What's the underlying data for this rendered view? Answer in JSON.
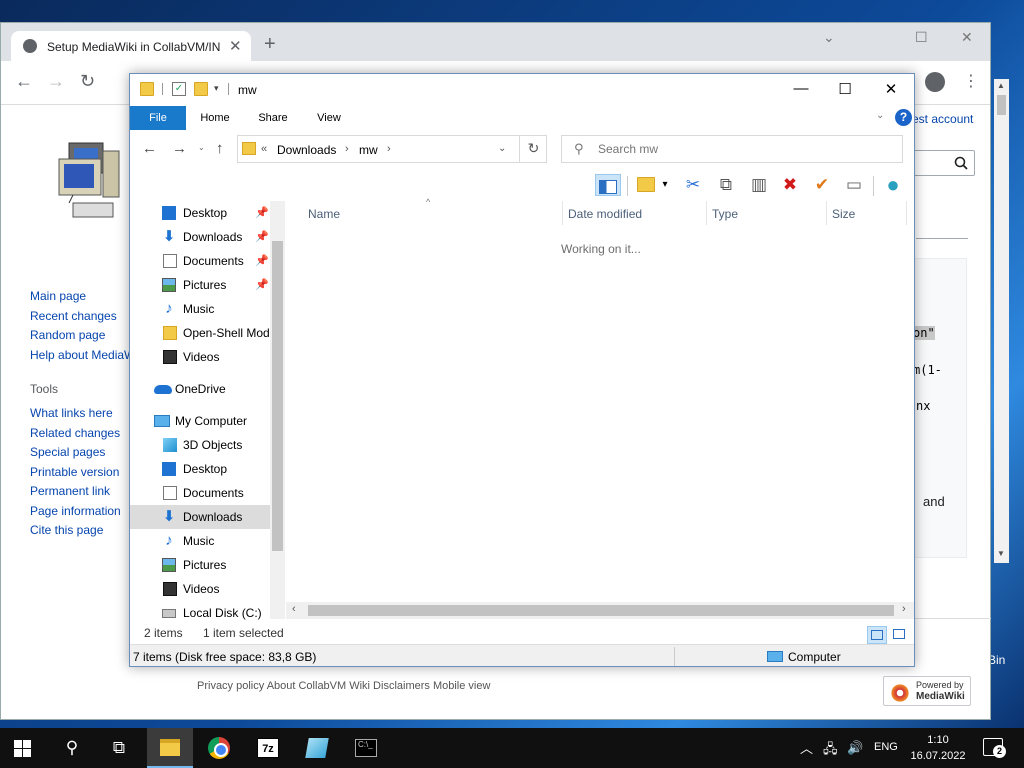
{
  "desktop": {
    "partial_label": "Bin"
  },
  "chrome": {
    "tab_title": "Setup MediaWiki in CollabVM/IN",
    "tab_close": "✕",
    "new_tab": "+",
    "ctrl_minimize": "⌄",
    "ctrl_restore": "☐",
    "ctrl_close": "✕",
    "nav_back": "←",
    "nav_forward": "→",
    "nav_reload": "↻",
    "menu": "⋮"
  },
  "wiki": {
    "nav_links": [
      "Main page",
      "Recent changes",
      "Random page",
      "Help about MediaWiki"
    ],
    "tools_heading": "Tools",
    "tools_links": [
      "What links here",
      "Related changes",
      "Special pages",
      "Printable version",
      "Permanent link",
      "Page information",
      "Cite this page"
    ],
    "account_link": "est account",
    "code_fragments": [
      "on\"",
      "m(1-",
      "nx"
    ],
    "text_fragment": "and",
    "footer_links": "Privacy policy   About CollabVM Wiki   Disclaimers   Mobile view",
    "powered_by_line1": "Powered by",
    "powered_by_line2": "MediaWiki"
  },
  "explorer": {
    "title": "mw",
    "window_minimize": "—",
    "window_maximize": "☐",
    "window_close": "✕",
    "ribbon_tabs": [
      "File",
      "Home",
      "Share",
      "View"
    ],
    "ribbon_collapse": "⌄",
    "help": "?",
    "nav_back": "←",
    "nav_forward": "→",
    "nav_recent": "⌄",
    "nav_up": "↑",
    "breadcrumb_overflow": "«",
    "breadcrumb": [
      "Downloads",
      "mw"
    ],
    "breadcrumb_separator": "›",
    "address_dropdown": "⌄",
    "refresh": "↻",
    "search_placeholder": "Search mw",
    "search_glyph": "⚲",
    "toolbar_glyphs": {
      "dropdown": "▾",
      "cut": "✂",
      "copy": "⧉",
      "paste": "▥",
      "delete": "✖",
      "apply": "✔",
      "rename": "▭",
      "globe": "●"
    },
    "toolbar_colors": {
      "cut": "#2a6fd6",
      "copy": "#555555",
      "paste": "#555555",
      "delete": "#d11a1a",
      "apply": "#e07a1a",
      "rename": "#666666",
      "globe": "#2aa0c0"
    },
    "nav_pane": {
      "quick_access": [
        {
          "label": "Desktop",
          "icon": "desktop-icon",
          "pinned": true
        },
        {
          "label": "Downloads",
          "icon": "downloads-icon",
          "pinned": true
        },
        {
          "label": "Documents",
          "icon": "documents-icon",
          "pinned": true
        },
        {
          "label": "Pictures",
          "icon": "pictures-icon",
          "pinned": true
        },
        {
          "label": "Music",
          "icon": "music-icon",
          "pinned": false
        },
        {
          "label": "Open-Shell Mod",
          "icon": "folder-icon",
          "pinned": false
        },
        {
          "label": "Videos",
          "icon": "videos-icon",
          "pinned": false
        }
      ],
      "onedrive": "OneDrive",
      "my_computer": "My Computer",
      "computer_items": [
        {
          "label": "3D Objects",
          "icon": "3d-objects-icon"
        },
        {
          "label": "Desktop",
          "icon": "desktop-icon"
        },
        {
          "label": "Documents",
          "icon": "documents-icon"
        },
        {
          "label": "Downloads",
          "icon": "downloads-icon",
          "selected": true
        },
        {
          "label": "Music",
          "icon": "music-icon"
        },
        {
          "label": "Pictures",
          "icon": "pictures-icon"
        },
        {
          "label": "Videos",
          "icon": "videos-icon"
        },
        {
          "label": "Local Disk (C:)",
          "icon": "local-disk-icon"
        }
      ],
      "pin_glyph": "📌",
      "down_glyph": "⬇",
      "music_glyph": "♪"
    },
    "columns": [
      "Name",
      "Date modified",
      "Type",
      "Size"
    ],
    "sort_indicator": "^",
    "status_message": "Working on it...",
    "scroll_left": "‹",
    "scroll_right": "›",
    "status_items": "2 items",
    "status_selected": "1 item selected",
    "status_bar_left": "7 items (Disk free space: 83,8 GB)",
    "status_bar_right": "Computer"
  },
  "taskbar": {
    "search_glyph": "⚲",
    "taskview_glyph": "⧉",
    "app_7z": "7z",
    "cmd_prompt": "C:\\_",
    "tray_chevron": "︿",
    "tray_network": "🖧",
    "tray_volume": "🔊",
    "language": "ENG",
    "time": "1:10",
    "date": "16.07.2022",
    "notifications": "2"
  }
}
